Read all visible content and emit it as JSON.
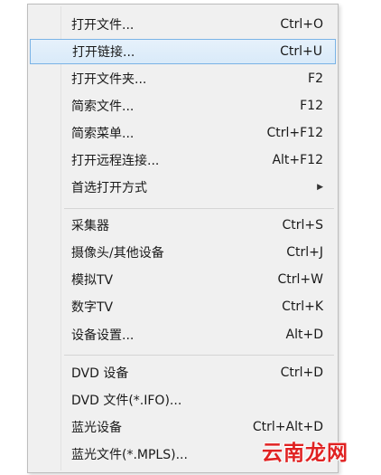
{
  "menu": {
    "items": [
      {
        "label": "打开文件...",
        "shortcut": "Ctrl+O"
      },
      {
        "label": "打开链接...",
        "shortcut": "Ctrl+U"
      },
      {
        "label": "打开文件夹...",
        "shortcut": "F2"
      },
      {
        "label": "简索文件...",
        "shortcut": "F12"
      },
      {
        "label": "简索菜单...",
        "shortcut": "Ctrl+F12"
      },
      {
        "label": "打开远程连接...",
        "shortcut": "Alt+F12"
      },
      {
        "label": "首选打开方式",
        "shortcut": ""
      },
      {
        "label": "采集器",
        "shortcut": "Ctrl+S"
      },
      {
        "label": "摄像头/其他设备",
        "shortcut": "Ctrl+J"
      },
      {
        "label": "模拟TV",
        "shortcut": "Ctrl+W"
      },
      {
        "label": "数字TV",
        "shortcut": "Ctrl+K"
      },
      {
        "label": "设备设置...",
        "shortcut": "Alt+D"
      },
      {
        "label": "DVD 设备",
        "shortcut": "Ctrl+D"
      },
      {
        "label": "DVD 文件(*.IFO)...",
        "shortcut": ""
      },
      {
        "label": "蓝光设备",
        "shortcut": "Ctrl+Alt+D"
      },
      {
        "label": "蓝光文件(*.MPLS)...",
        "shortcut": ""
      }
    ],
    "highlight_color": "#7ab3e6"
  },
  "watermark": {
    "text": "云南龙网",
    "color": "#e02222"
  }
}
